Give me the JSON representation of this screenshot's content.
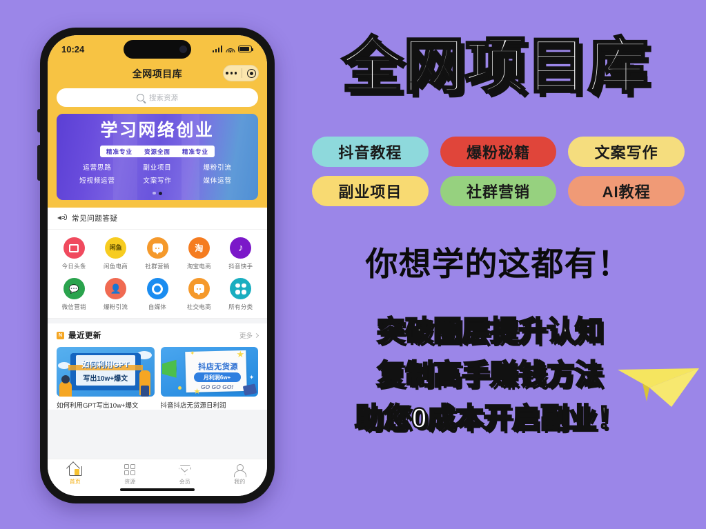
{
  "theme": {
    "background": "#9b86e8",
    "phone_accent": "#f7c343",
    "banner_gradient_start": "#5b3fd4",
    "banner_gradient_end": "#4f8fd4"
  },
  "phone": {
    "status_bar": {
      "time": "10:24"
    },
    "app_header": {
      "title": "全网项目库"
    },
    "search": {
      "placeholder": "搜索资源"
    },
    "banner": {
      "title": "学习网络创业",
      "strip": [
        "精准专业",
        "资源全面",
        "精准专业"
      ],
      "rows": [
        [
          "运营思路",
          "副业项目",
          "爆粉引流"
        ],
        [
          "短视频运营",
          "文案写作",
          "媒体运营"
        ]
      ],
      "dots_total": 2,
      "dots_active": 2
    },
    "notice": {
      "label": "常见问题答疑"
    },
    "grid": [
      {
        "label": "今日头条",
        "color": "#f04a5e",
        "glyph": "news-icon"
      },
      {
        "label": "闲鱼电商",
        "color": "#f7cc20",
        "glyph": "xianyu-icon"
      },
      {
        "label": "社群营销",
        "color": "#f5992b",
        "glyph": "chat-icon"
      },
      {
        "label": "淘宝电商",
        "color": "#f57c20",
        "glyph": "taobao-icon"
      },
      {
        "label": "抖音快手",
        "color": "#7b18c9",
        "glyph": "douyin-icon"
      },
      {
        "label": "微信营销",
        "color": "#2aa34d",
        "glyph": "wechat-icon"
      },
      {
        "label": "爆粉引流",
        "color": "#f06a52",
        "glyph": "person-plus-icon"
      },
      {
        "label": "自媒体",
        "color": "#1a8cf0",
        "glyph": "ring-icon"
      },
      {
        "label": "社交电商",
        "color": "#f5992b",
        "glyph": "chat-icon"
      },
      {
        "label": "所有分类",
        "color": "#19aec0",
        "glyph": "clover-icon"
      }
    ],
    "recent": {
      "title": "最近更新",
      "badge": "N",
      "more": "更多",
      "cards": [
        {
          "caption": "如何利用GPT写出10w+爆文",
          "thumb_line1": "如何利用GPT",
          "thumb_line2": "写出10w+爆文"
        },
        {
          "caption": "抖音抖店无货源日利润",
          "thumb_line1": "抖店无货源",
          "thumb_line2": "月利润6w+",
          "thumb_line3": "GO GO GO!"
        }
      ]
    },
    "tabbar": [
      {
        "label": "首页",
        "icon": "home-icon",
        "active": true
      },
      {
        "label": "资源",
        "icon": "grid-icon",
        "active": false
      },
      {
        "label": "会员",
        "icon": "vip-diamond-icon",
        "active": false
      },
      {
        "label": "我的",
        "icon": "person-icon",
        "active": false
      }
    ]
  },
  "poster": {
    "main_title": "全网项目库",
    "tags": [
      {
        "label": "抖音教程",
        "color": "#8ed9dc"
      },
      {
        "label": "爆粉秘籍",
        "color": "#e0453a"
      },
      {
        "label": "文案写作",
        "color": "#f5dd7e"
      },
      {
        "label": "副业项目",
        "color": "#f8da72"
      },
      {
        "label": "社群营销",
        "color": "#96d17f"
      },
      {
        "label": "AI教程",
        "color": "#f09a76"
      }
    ],
    "slogan": "你想学的这都有！",
    "lines": [
      "突破圈层提升认知",
      "复制高手赚钱方法",
      "助您0成本开启副业！"
    ],
    "plane_color": "#f5e55f"
  }
}
